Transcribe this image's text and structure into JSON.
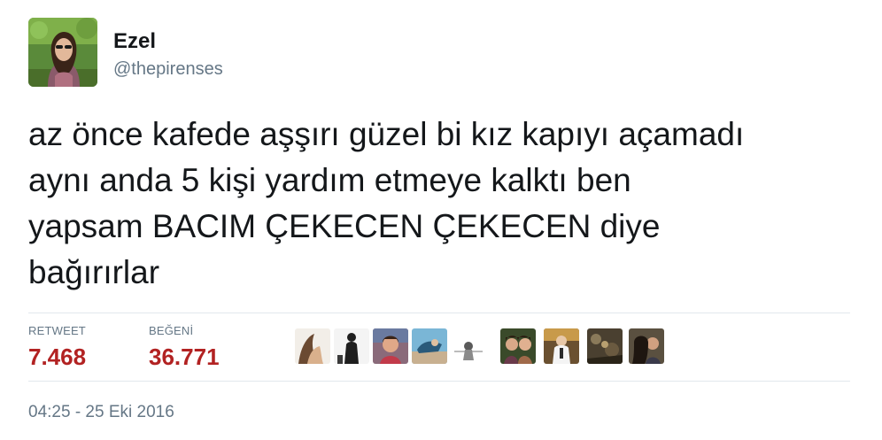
{
  "user": {
    "display_name": "Ezel",
    "handle": "@thepirenses"
  },
  "tweet": {
    "text": "az önce kafede aşşırı güzel bi kız kapıyı açamadı\naynı anda 5 kişi yardım etmeye kalktı ben\nyapsam BACIM ÇEKECEN ÇEKECEN diye\nbağırırlar"
  },
  "stats": {
    "retweet_label": "RETWEET",
    "retweet_count": "7.468",
    "like_label": "BEĞENİ",
    "like_count": "36.771"
  },
  "likers_icon": "user-avatar-icon",
  "timestamp": "04:25 - 25 Eki 2016",
  "colors": {
    "stat_value": "#b22222",
    "muted": "#657786",
    "divider": "#e1e8ed",
    "text": "#14171a"
  }
}
